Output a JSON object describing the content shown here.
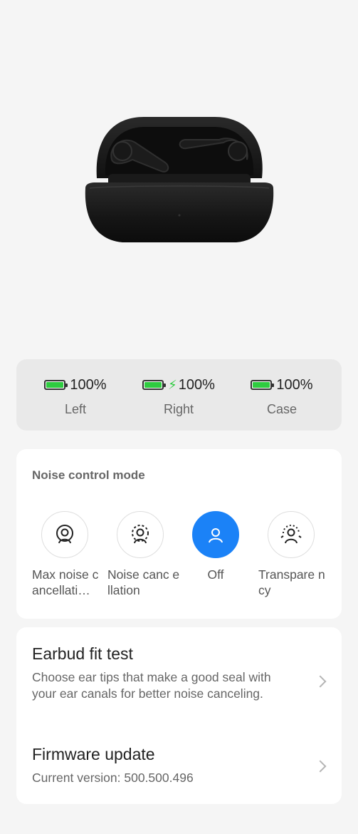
{
  "battery": {
    "left": {
      "percent": "100%",
      "label": "Left",
      "level": 100,
      "charging": false
    },
    "right": {
      "percent": "100%",
      "label": "Right",
      "level": 100,
      "charging": true
    },
    "case": {
      "percent": "100%",
      "label": "Case",
      "level": 100,
      "charging": false
    }
  },
  "noise_control": {
    "title": "Noise control mode",
    "modes": [
      {
        "label": "Max noise cancellati…",
        "icon": "max-noise-cancellation-icon",
        "selected": false
      },
      {
        "label": "Noise canc ellation",
        "icon": "noise-cancellation-icon",
        "selected": false
      },
      {
        "label": "Off",
        "icon": "noise-off-icon",
        "selected": true
      },
      {
        "label": "Transpare ncy",
        "icon": "transparency-icon",
        "selected": false
      }
    ]
  },
  "settings": {
    "fit_test": {
      "title": "Earbud fit test",
      "description": "Choose ear tips that make a good seal with your ear canals for better noise canceling."
    },
    "firmware": {
      "title": "Firmware update",
      "description": "Current version: 500.500.496"
    }
  },
  "colors": {
    "accent": "#1b82f7",
    "battery_fill": "#2ecc40",
    "background": "#f5f5f5"
  }
}
